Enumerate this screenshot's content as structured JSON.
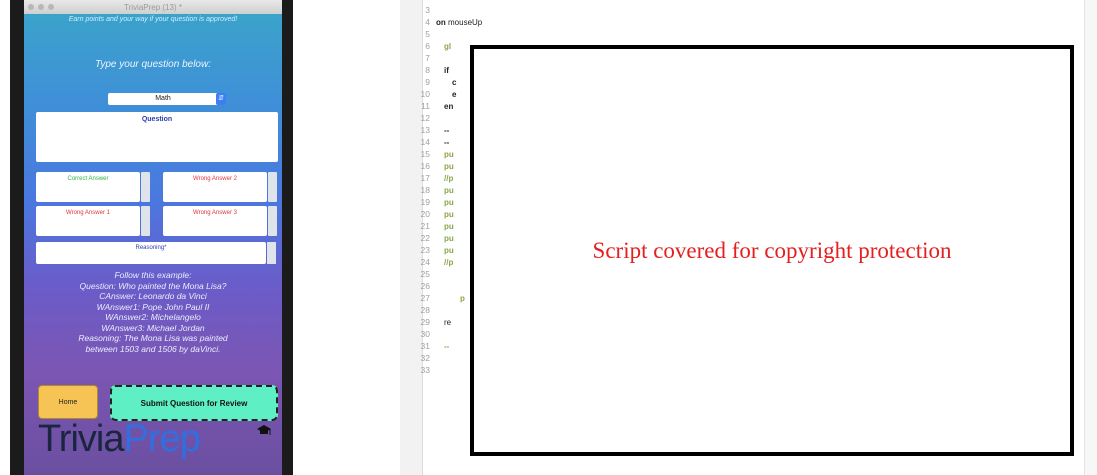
{
  "phone": {
    "window_title": "TriviaPrep (13) *",
    "earn_text": "Earn points and your way if your question is approved!",
    "prompt": "Type your question below:",
    "subject_value": "Math",
    "question_placeholder": "Question",
    "correct_answer": "Correct Answer",
    "wrong_answer_1": "Wrong Answer 1",
    "wrong_answer_2": "Wrong Answer 2",
    "wrong_answer_3": "Wrong Answer 3",
    "reasoning": "Reasoning*",
    "example_lines": [
      "Follow this example:",
      "Question:  Who painted the Mona Lisa?",
      "CAnswer: Leonardo da Vinci",
      "WAnswer1: Pope John Paul II",
      "WAnswer2: Michelangelo",
      "WAnswer3: Michael Jordan",
      "Reasoning:  The Mona Lisa was painted",
      "between 1503 and 1506 by daVinci."
    ],
    "home_label": "Home",
    "submit_label": "Submit Question for Review",
    "logo_part1": "Trivia",
    "logo_part2": "Prep"
  },
  "editor": {
    "line_numbers": [
      "3",
      "4",
      "5",
      "6",
      "7",
      "8",
      "9",
      "10",
      "11",
      "12",
      "13",
      "14",
      "15",
      "16",
      "17",
      "18",
      "19",
      "20",
      "21",
      "22",
      "23",
      "24",
      "25",
      "26",
      "27",
      "28",
      "29",
      "30",
      "31",
      "32",
      "33"
    ],
    "code_line_4_keyword": "on",
    "code_line_4_rest": "mouseUp",
    "partial_lines": {
      "l6": "gl",
      "l8": "if",
      "l9": "c",
      "l10": "e",
      "l11": "en",
      "l13": "--",
      "l14": "--",
      "l15": "pu",
      "l16": "pu",
      "l17": "//p",
      "l18": "pu",
      "l19": "pu",
      "l20": "pu",
      "l21": "pu",
      "l22": "pu",
      "l23": "pu",
      "l24": "//p",
      "l27": "p",
      "l29": "re",
      "l31": "--"
    },
    "cover_text": "Script covered for copyright protection"
  },
  "colors": {
    "cover_text": "#e41f1f",
    "submit_button": "#5ef0c4",
    "home_button": "#f6c455"
  }
}
